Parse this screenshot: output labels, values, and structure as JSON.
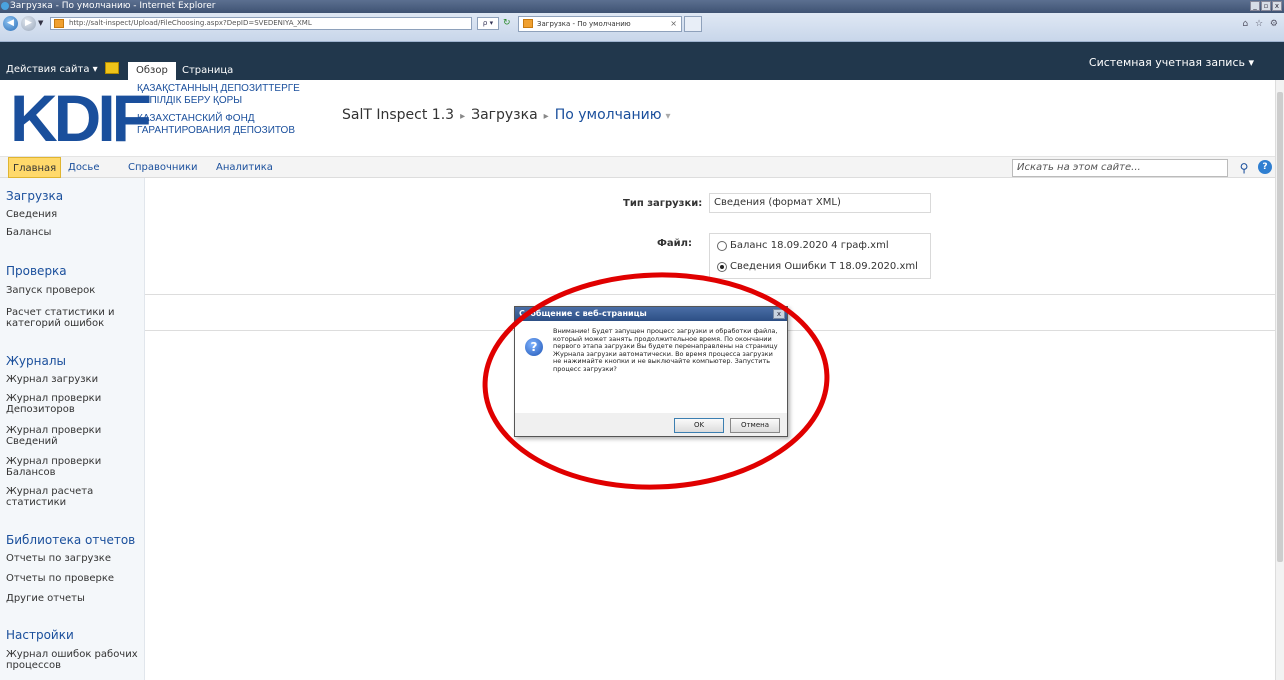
{
  "browser": {
    "window_title": "Загрузка - По умолчанию - Internet Explorer",
    "url": "http://salt-inspect/Upload/FileChoosing.aspx?DepID=SVEDENIYA_XML",
    "search_glyph": "ρ ▾",
    "tab_title": "Загрузка - По умолчанию",
    "tab_close": "×"
  },
  "ribbon": {
    "site_actions": "Действия сайта ▾",
    "tab_browse": "Обзор",
    "tab_page": "Страница",
    "account": "Системная учетная запись ▾"
  },
  "header": {
    "logo": "KDIF",
    "logo_line1": "ҚАЗАҚСТАННЫҢ ДЕПОЗИТТЕРГЕ",
    "logo_line2": "КЕПІЛДІК БЕРУ ҚОРЫ",
    "logo_line3": "КАЗАХСТАНСКИЙ ФОНД",
    "logo_line4": "ГАРАНТИРОВАНИЯ ДЕПОЗИТОВ",
    "breadcrumb": [
      "SalT Inspect 1.3",
      "Загрузка",
      "По умолчанию"
    ]
  },
  "topnav": {
    "items": [
      "Главная",
      "Досье",
      "Справочники",
      "Аналитика"
    ],
    "search_placeholder": "Искать на этом сайте..."
  },
  "leftnav": {
    "sections": [
      {
        "title": "Загрузка",
        "items": [
          "Сведения",
          "Балансы"
        ]
      },
      {
        "title": "Проверка",
        "items": [
          "Запуск проверок",
          "Расчет статистики и категорий ошибок"
        ]
      },
      {
        "title": "Журналы",
        "items": [
          "Журнал загрузки",
          "Журнал проверки Депозиторов",
          "Журнал проверки Сведений",
          "Журнал проверки Балансов",
          "Журнал расчета статистики"
        ]
      },
      {
        "title": "Библиотека отчетов",
        "items": [
          "Отчеты по загрузке",
          "Отчеты по проверке",
          "Другие отчеты"
        ]
      },
      {
        "title": "Настройки",
        "items": [
          "Журнал ошибок рабочих процессов"
        ]
      }
    ]
  },
  "form": {
    "type_label": "Тип загрузки:",
    "type_value": "Сведения (формат XML)",
    "file_label": "Файл:",
    "files": [
      {
        "name": "Баланс 18.09.2020 4 граф.xml",
        "selected": false
      },
      {
        "name": "Сведения Ошибки Т 18.09.2020.xml",
        "selected": true
      }
    ]
  },
  "dialog": {
    "title": "Сообщение с веб-страницы",
    "message": "Внимание! Будет запущен процесс загрузки и обработки файла, который может занять продолжительное время. По окончании первого этапа загрузки Вы будете перенаправлены на страницу Журнала загрузки автоматически. Во время процесса загрузки не нажимайте кнопки и не выключайте компьютер. Запустить процесс загрузки?",
    "ok": "OK",
    "cancel": "Отмена"
  },
  "colors": {
    "ribbon": "#21374c",
    "brand_blue": "#1a4f9c",
    "annotation": "#e00000"
  }
}
